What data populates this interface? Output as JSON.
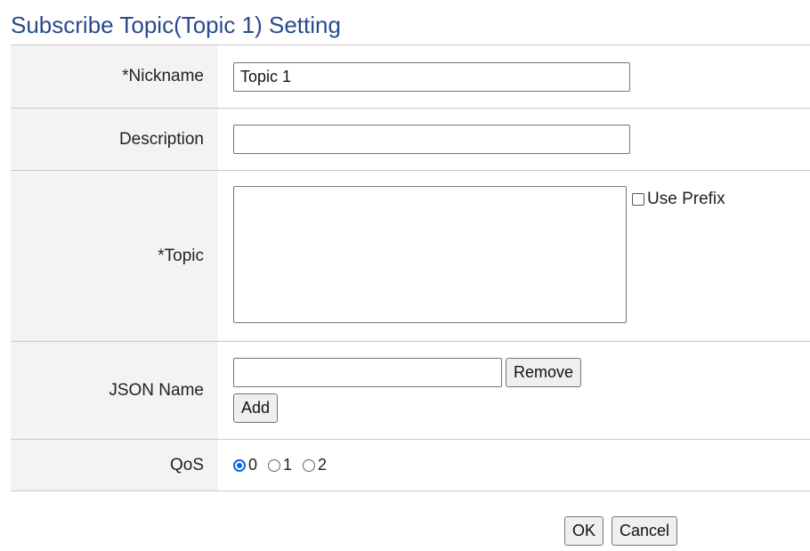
{
  "title": "Subscribe Topic(Topic 1) Setting",
  "form": {
    "nickname": {
      "label": "*Nickname",
      "value": "Topic 1"
    },
    "description": {
      "label": "Description",
      "value": ""
    },
    "topic": {
      "label": "*Topic",
      "value": "",
      "use_prefix_label": "Use Prefix",
      "use_prefix_checked": false
    },
    "json_name": {
      "label": "JSON Name",
      "value": "",
      "remove_label": "Remove",
      "add_label": "Add"
    },
    "qos": {
      "label": "QoS",
      "options": [
        "0",
        "1",
        "2"
      ],
      "selected": "0"
    }
  },
  "footer": {
    "ok_label": "OK",
    "cancel_label": "Cancel"
  }
}
